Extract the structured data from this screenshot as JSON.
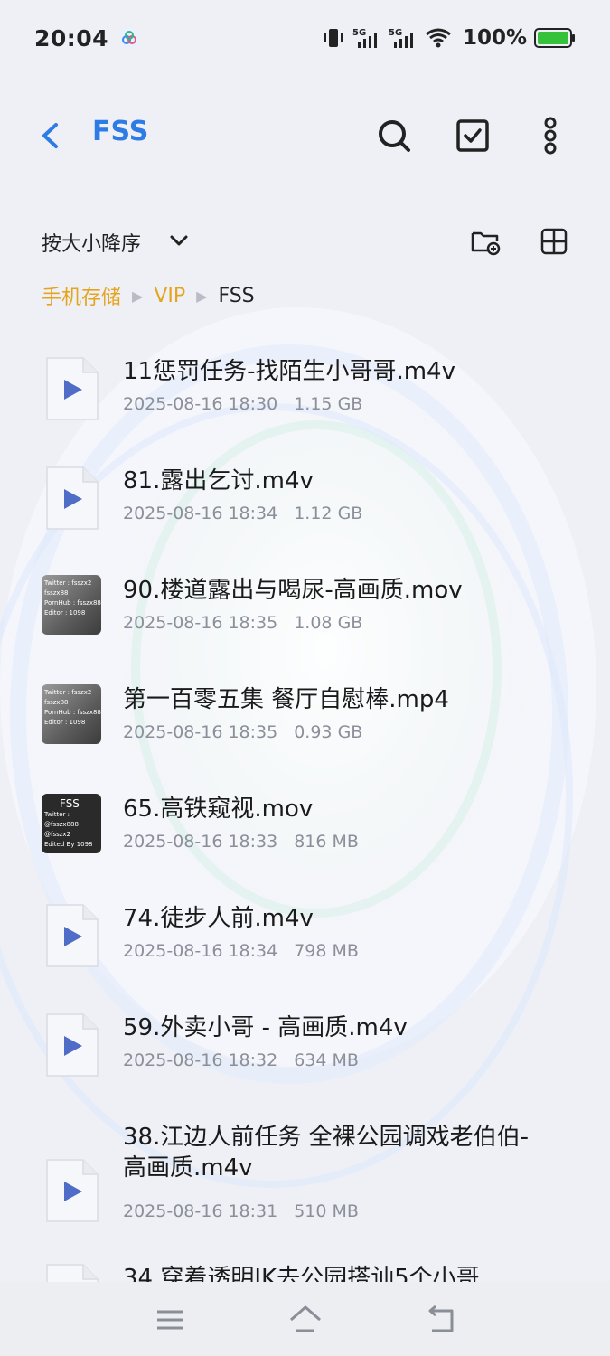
{
  "status": {
    "time": "20:04",
    "network1": "5G",
    "network2": "5G",
    "battery": "100%",
    "battery_color": "#35c23a"
  },
  "header": {
    "title": "FSS",
    "accent_color": "#2d7be5",
    "icons": [
      "back-icon",
      "search-icon",
      "checkbox-icon",
      "more-icon"
    ]
  },
  "toolbar": {
    "sort_label": "按大小降序",
    "icons": [
      "new-folder-icon",
      "grid-view-icon"
    ]
  },
  "breadcrumb": {
    "items": [
      "手机存储",
      "VIP",
      "FSS"
    ],
    "active_color": "#e5a41d"
  },
  "files": [
    {
      "name": "11惩罚任务-找陌生小哥哥.m4v",
      "date": "2025-08-16 18:30",
      "size": "1.15 GB",
      "thumb": "video"
    },
    {
      "name": "81.露出乞讨.m4v",
      "date": "2025-08-16 18:34",
      "size": "1.12 GB",
      "thumb": "video"
    },
    {
      "name": "90.楼道露出与喝尿-高画质.mov",
      "date": "2025-08-16 18:35",
      "size": "1.08 GB",
      "thumb": "image",
      "thumb_text": [
        "Twitter : fsszx2",
        "fsszx88",
        "PornHub : fsszx888",
        "Editor : 1098"
      ]
    },
    {
      "name": "第一百零五集 餐厅自慰棒.mp4",
      "date": "2025-08-16 18:35",
      "size": "0.93 GB",
      "thumb": "image",
      "thumb_text": [
        "Twitter : fsszx2",
        "fsszx88",
        "PornHub : fsszx888",
        "Editor : 1098"
      ]
    },
    {
      "name": "65.高铁窥视.mov",
      "date": "2025-08-16 18:33",
      "size": "816 MB",
      "thumb": "image-dark",
      "thumb_text": [
        "FSS",
        "Twitter :",
        "@fsszx888",
        "@fsszx2",
        "Edited By 1098"
      ]
    },
    {
      "name": "74.徒步人前.m4v",
      "date": "2025-08-16 18:34",
      "size": "798 MB",
      "thumb": "video"
    },
    {
      "name": "59.外卖小哥 - 高画质.m4v",
      "date": "2025-08-16 18:32",
      "size": "634 MB",
      "thumb": "video"
    },
    {
      "name": "38.江边人前任务 全裸公园调戏老伯伯-高画质.m4v",
      "date": "2025-08-16 18:31",
      "size": "510 MB",
      "thumb": "video"
    },
    {
      "name": "34.穿着透明JK去公园搭讪5个小哥",
      "date": "",
      "size": "",
      "thumb": "video"
    }
  ],
  "nav": {
    "icons": [
      "menu-icon",
      "home-icon",
      "back-nav-icon"
    ]
  }
}
